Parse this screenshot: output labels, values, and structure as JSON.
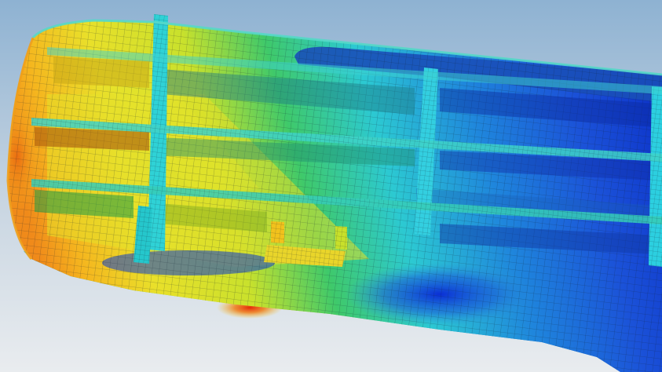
{
  "scene": {
    "subject": "",
    "colors": {
      "background_top": "#8fb3d3",
      "background_bottom": "#e8ebee",
      "mesh_line": "#1a2a3a",
      "stress_max": "#e8300a",
      "stress_high": "#f5a21a",
      "stress_mid_high": "#e6e32a",
      "stress_mid": "#3fc86a",
      "stress_mid_low": "#2fd3d8",
      "stress_low": "#1f6fd8",
      "stress_min": "#0a2bd0"
    }
  }
}
